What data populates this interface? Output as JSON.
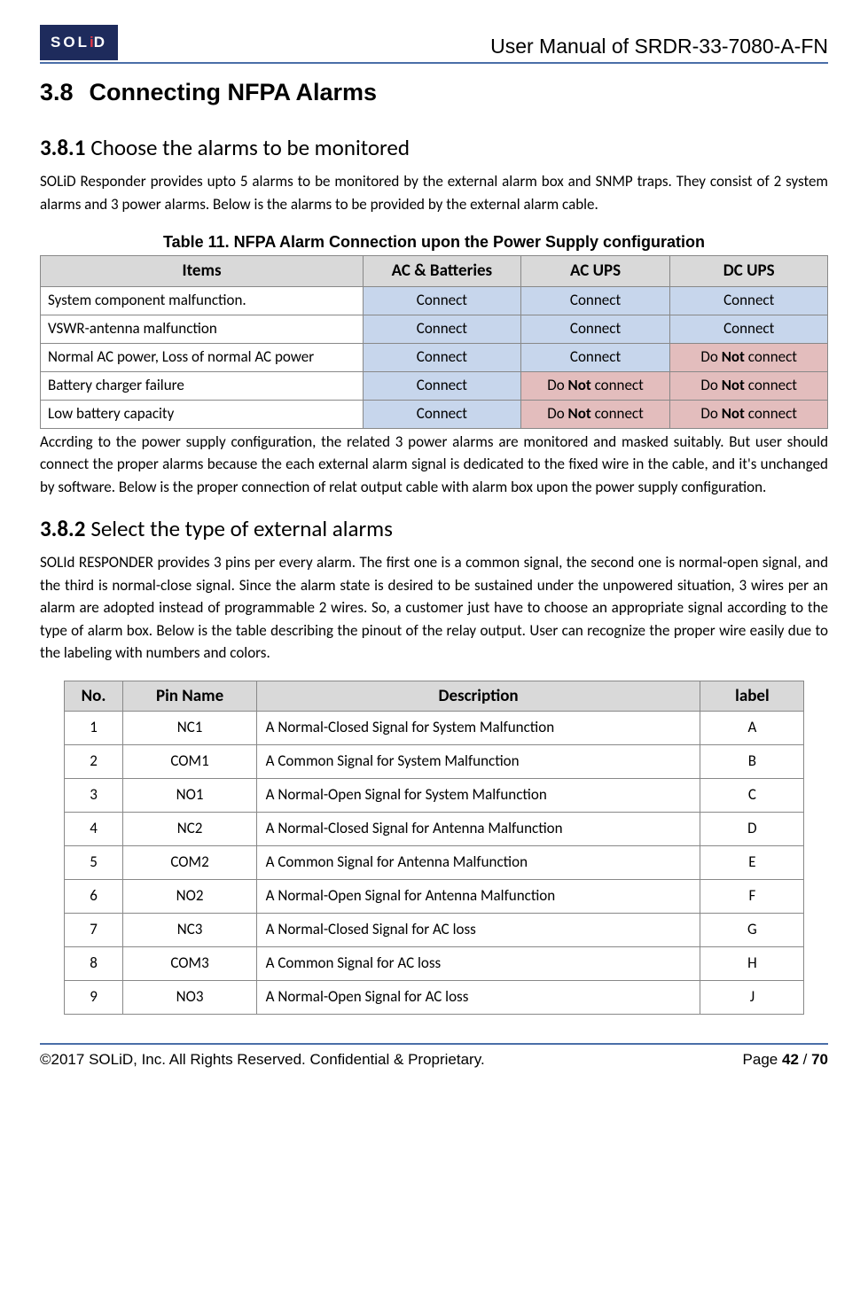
{
  "header": {
    "brand": "SOLiD",
    "doc_title": "User Manual of SRDR-33-7080-A-FN"
  },
  "section": {
    "num": "3.8",
    "title": "Connecting NFPA Alarms"
  },
  "sub1": {
    "num": "3.8.1",
    "title": "Choose the alarms to be monitored",
    "para": "SOLiD Responder provides upto 5 alarms to be monitored by the external alarm box and SNMP traps. They consist of 2 system alarms and 3 power alarms.    Below is the alarms to be provided by the external alarm cable."
  },
  "table1": {
    "caption": "Table 11. NFPA Alarm Connection upon the Power Supply configuration",
    "headers": [
      "Items",
      "AC & Batteries",
      "AC UPS",
      "DC UPS"
    ],
    "rows": [
      {
        "item": "System component malfunction.",
        "cells": [
          {
            "text": "Connect",
            "cls": "cell-connect",
            "bold": ""
          },
          {
            "text": "Connect",
            "cls": "cell-connect",
            "bold": ""
          },
          {
            "text": "Connect",
            "cls": "cell-connect",
            "bold": ""
          }
        ]
      },
      {
        "item": "VSWR-antenna malfunction",
        "cells": [
          {
            "text": "Connect",
            "cls": "cell-connect",
            "bold": ""
          },
          {
            "text": "Connect",
            "cls": "cell-connect",
            "bold": ""
          },
          {
            "text": "Connect",
            "cls": "cell-connect",
            "bold": ""
          }
        ]
      },
      {
        "item": "Normal AC power, Loss of normal AC power",
        "cells": [
          {
            "text": "Connect",
            "cls": "cell-connect",
            "bold": ""
          },
          {
            "text": "Connect",
            "cls": "cell-connect",
            "bold": ""
          },
          {
            "pre": "Do ",
            "bold": "Not",
            "post": " connect",
            "cls": "cell-noconnect"
          }
        ]
      },
      {
        "item": "Battery charger failure",
        "cells": [
          {
            "text": "Connect",
            "cls": "cell-connect",
            "bold": ""
          },
          {
            "pre": "Do ",
            "bold": "Not",
            "post": " connect",
            "cls": "cell-noconnect"
          },
          {
            "pre": "Do ",
            "bold": "Not",
            "post": " connect",
            "cls": "cell-noconnect"
          }
        ]
      },
      {
        "item": "Low battery capacity",
        "cells": [
          {
            "text": "Connect",
            "cls": "cell-connect",
            "bold": ""
          },
          {
            "pre": "Do ",
            "bold": "Not",
            "post": " connect",
            "cls": "cell-noconnect"
          },
          {
            "pre": "Do ",
            "bold": "Not",
            "post": " connect",
            "cls": "cell-noconnect"
          }
        ]
      }
    ],
    "after": "Accrding to the power supply configuration, the related 3 power alarms are monitored and masked suitably. But user should connect the proper alarms because the each external alarm signal is dedicated to the fixed wire in the cable, and it's unchanged by software. Below is the proper connection of relat output cable with alarm box upon the power supply configuration."
  },
  "sub2": {
    "num": "3.8.2",
    "title": "Select the type of external alarms",
    "para": "SOLId RESPONDER provides 3 pins per every alarm. The first one is a common signal, the second one is normal-open signal, and the third is normal-close signal. Since the alarm state is desired to be sustained under the unpowered situation, 3 wires per an alarm are adopted instead of programmable 2 wires. So, a customer just have to choose an appropriate signal according to the type of alarm box. Below is the table describing the pinout of the relay output. User can recognize the proper wire easily due to the labeling with numbers and colors."
  },
  "table2": {
    "headers": [
      "No.",
      "Pin Name",
      "Description",
      "label"
    ],
    "rows": [
      {
        "no": "1",
        "pin": "NC1",
        "desc": "A Normal-Closed Signal for System Malfunction",
        "lbl": "A"
      },
      {
        "no": "2",
        "pin": "COM1",
        "desc": "A Common Signal for System Malfunction",
        "lbl": "B"
      },
      {
        "no": "3",
        "pin": "NO1",
        "desc": "A Normal-Open Signal for System Malfunction",
        "lbl": "C"
      },
      {
        "no": "4",
        "pin": "NC2",
        "desc": "A Normal-Closed Signal for Antenna Malfunction",
        "lbl": "D"
      },
      {
        "no": "5",
        "pin": "COM2",
        "desc": "A Common Signal for Antenna Malfunction",
        "lbl": "E"
      },
      {
        "no": "6",
        "pin": "NO2",
        "desc": "A Normal-Open Signal for Antenna Malfunction",
        "lbl": "F"
      },
      {
        "no": "7",
        "pin": "NC3",
        "desc": "A Normal-Closed Signal for AC loss",
        "lbl": "G"
      },
      {
        "no": "8",
        "pin": "COM3",
        "desc": "A Common Signal for AC loss",
        "lbl": "H"
      },
      {
        "no": "9",
        "pin": "NO3",
        "desc": "A Normal-Open Signal for AC loss",
        "lbl": "J"
      }
    ]
  },
  "footer": {
    "copyright": "©2017 SOLiD, Inc. All Rights Reserved. Confidential & Proprietary.",
    "page_label": "Page ",
    "page_current": "42",
    "page_sep": " / ",
    "page_total": "70"
  }
}
